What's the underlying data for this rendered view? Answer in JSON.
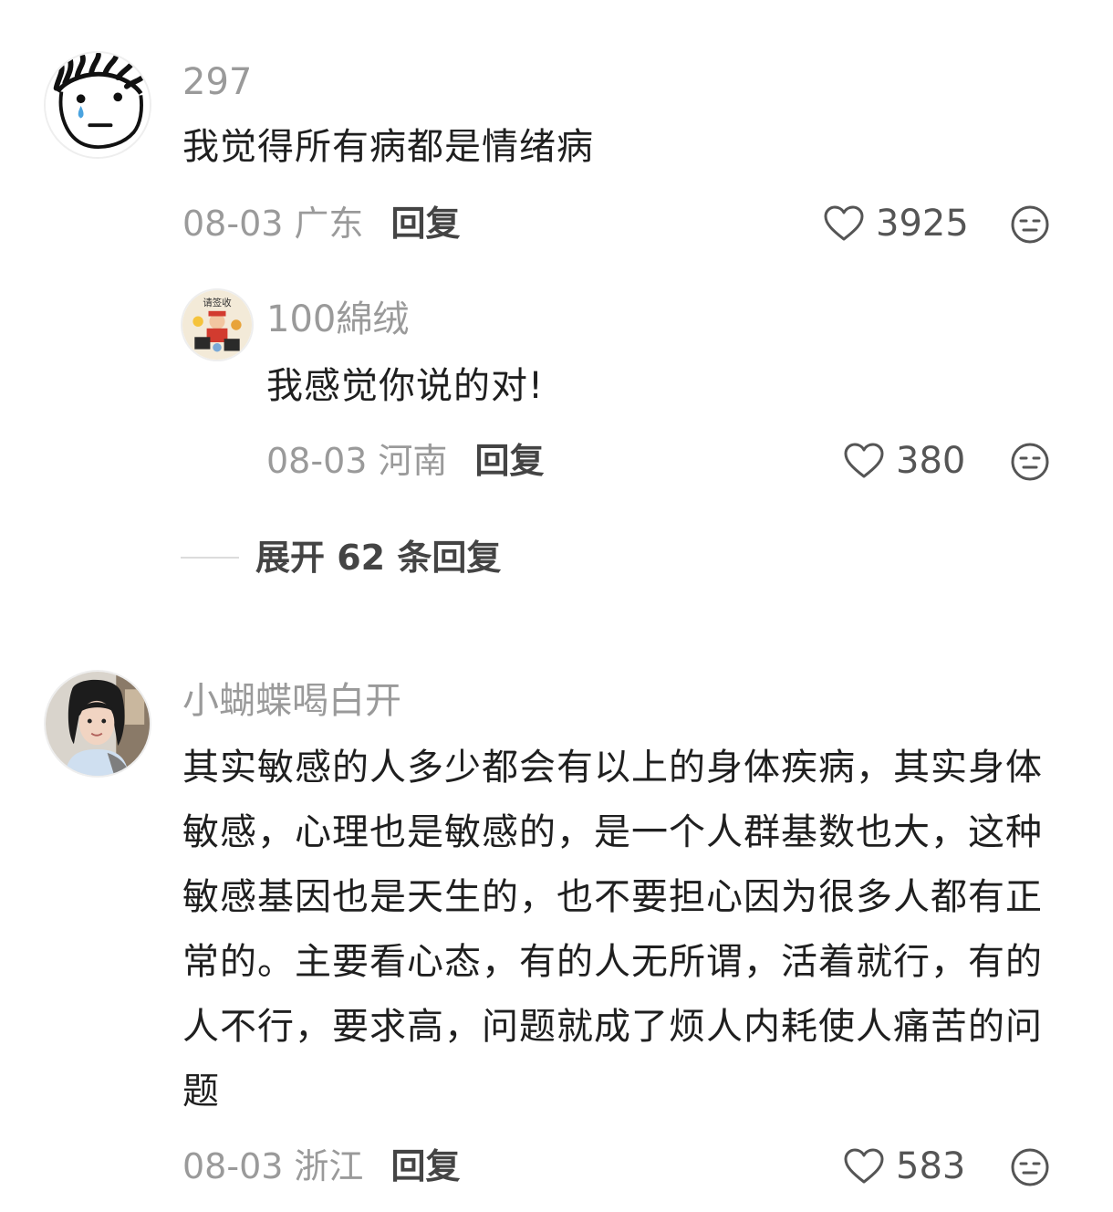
{
  "comments": [
    {
      "username": "297",
      "text": "我觉得所有病都是情绪病",
      "date": "08-03",
      "location": "广东",
      "reply_label": "回复",
      "likes": "3925",
      "replies": [
        {
          "username": "100綿绒",
          "text": "我感觉你说的对!",
          "date": "08-03",
          "location": "河南",
          "reply_label": "回复",
          "likes": "380"
        }
      ],
      "expand_label": "展开 62 条回复"
    },
    {
      "username": "小蝴蝶喝白开",
      "text": "其实敏感的人多少都会有以上的身体疾病，其实身体敏感，心理也是敏感的，是一个人群基数也大，这种敏感基因也是天生的，也不要担心因为很多人都有正常的。主要看心态，有的人无所谓，活着就行，有的人不行，要求高，问题就成了烦人内耗使人痛苦的问题",
      "date": "08-03",
      "location": "浙江",
      "reply_label": "回复",
      "likes": "583"
    }
  ],
  "icons": {
    "like": "heart-outline-icon",
    "dislike": "neutral-face-icon"
  },
  "colors": {
    "username": "#9a9a9a",
    "text": "#1f1f1f",
    "meta": "#9a9a9a",
    "reply": "#444444",
    "icon": "#555555"
  }
}
